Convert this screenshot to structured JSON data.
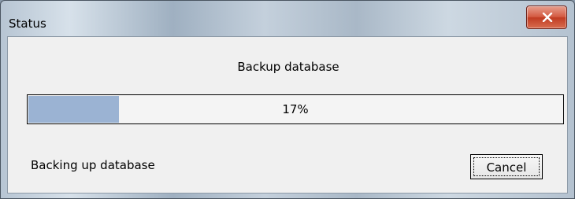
{
  "window": {
    "title": "Status"
  },
  "titlebar": {
    "close_icon": "close-x-icon"
  },
  "dialog": {
    "heading": "Backup database",
    "progress": {
      "value": 0.17,
      "label": "17%"
    },
    "status_text": "Backing up database",
    "cancel_label": "Cancel"
  }
}
